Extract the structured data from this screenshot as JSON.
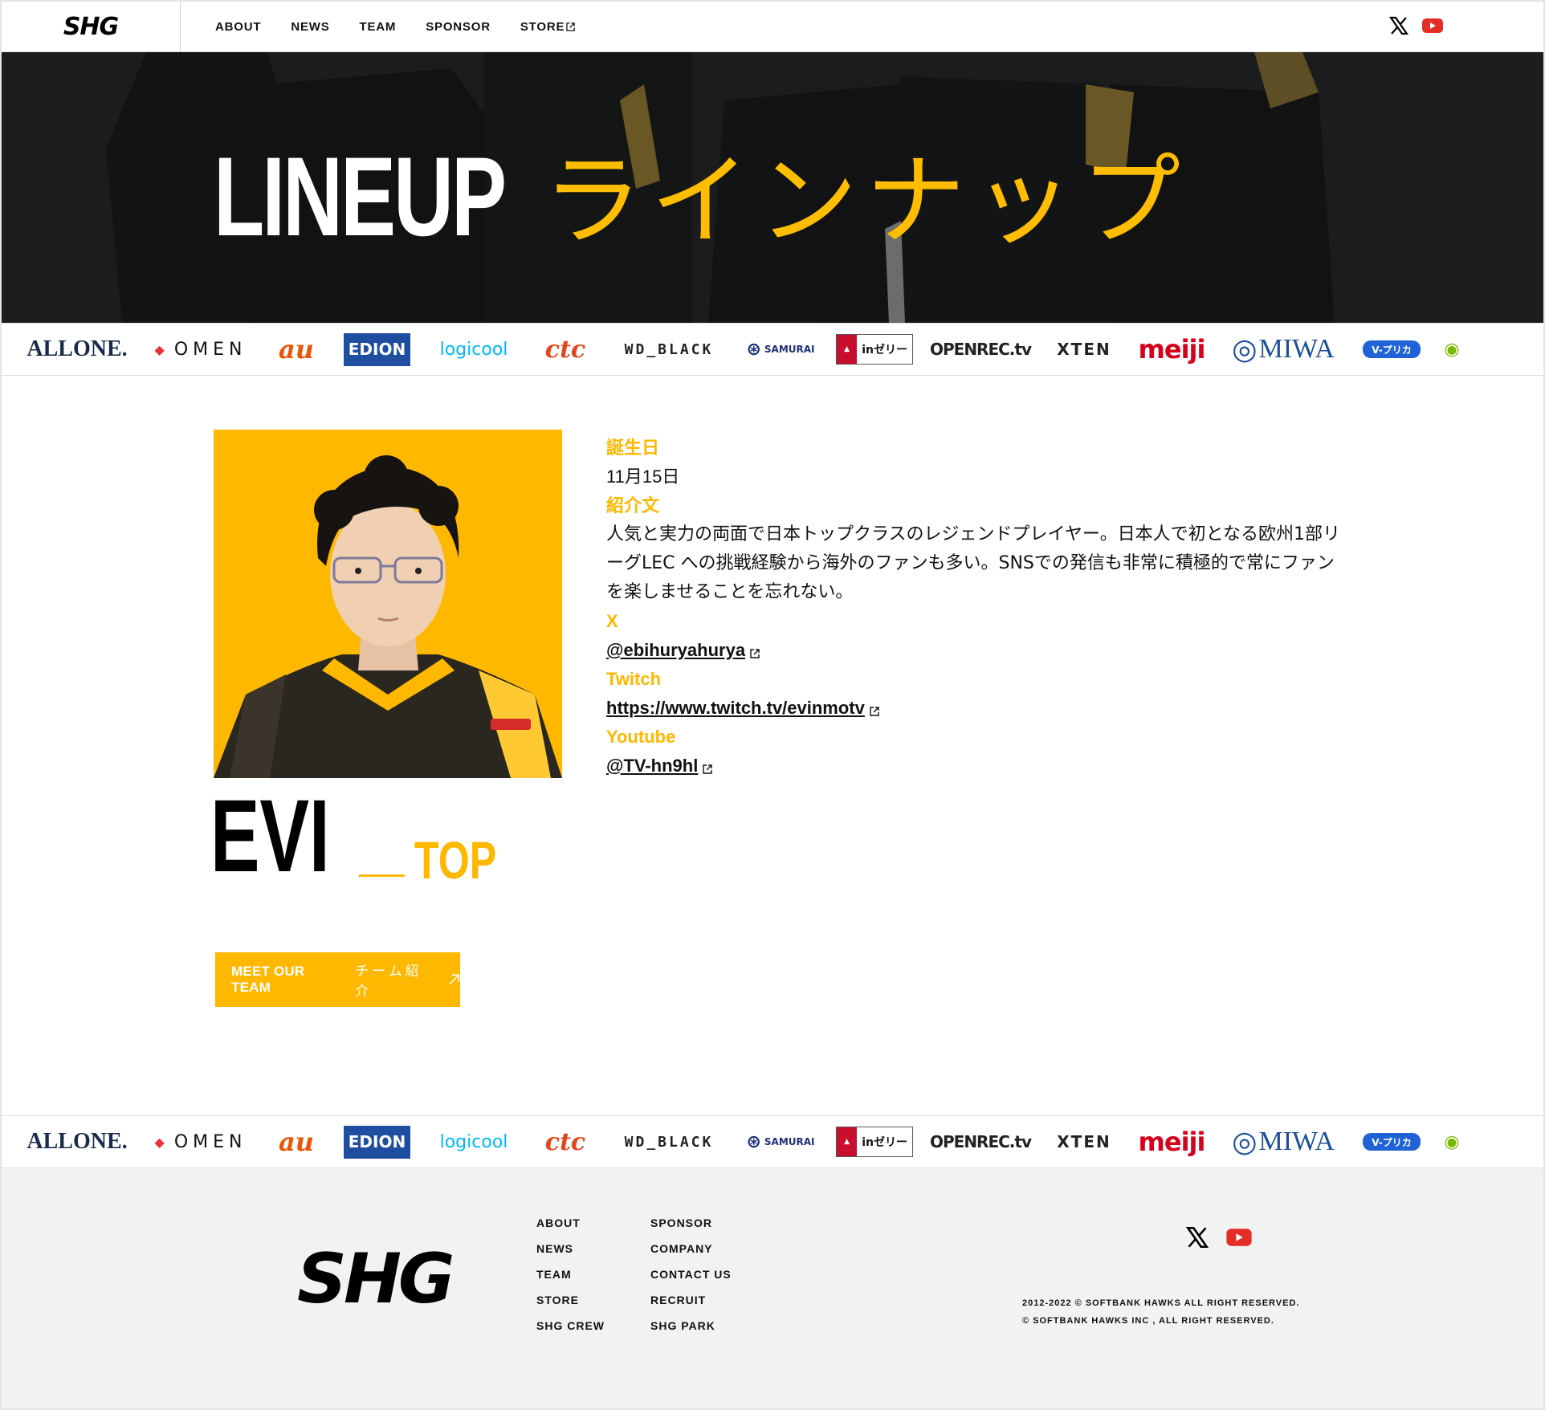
{
  "header": {
    "logo": "SHG",
    "nav": [
      {
        "label": "ABOUT"
      },
      {
        "label": "NEWS"
      },
      {
        "label": "TEAM"
      },
      {
        "label": "SPONSOR"
      },
      {
        "label": "STORE"
      }
    ]
  },
  "hero": {
    "title_en": "LINEUP",
    "title_jp": "ラインナップ"
  },
  "sponsors": [
    "ALLONE.",
    "OMEN",
    "au",
    "EDION",
    "logicool",
    "ctc",
    "WD_BLACK",
    "SAMURAI",
    "inゼリー",
    "OPENREC.tv",
    "XTEN",
    "meiji",
    "MIWA",
    "V-プリカ",
    "NVIDIA"
  ],
  "player": {
    "name": "EVI",
    "role": "TOP",
    "birthday_label": "誕生日",
    "birthday": "11月15日",
    "bio_label": "紹介文",
    "bio": "人気と実力の両面で日本トップクラスのレジェンドプレイヤー。日本人で初となる欧州1部リーグLEC への挑戦経験から海外のファンも多い。SNSでの発信も非常に積極的で常にファンを楽しませることを忘れない。",
    "x_label": "X",
    "x_handle": "@ebihuryahurya",
    "twitch_label": "Twitch",
    "twitch_url": "https://www.twitch.tv/evinmotv",
    "youtube_label": "Youtube",
    "youtube_handle": "@TV-hn9hl"
  },
  "team_button": {
    "en": "MEET OUR TEAM",
    "jp": "チーム紹介"
  },
  "footer": {
    "logo": "SHG",
    "col1": [
      "ABOUT",
      "NEWS",
      "TEAM",
      "STORE",
      "SHG CREW"
    ],
    "col2": [
      "SPONSOR",
      "COMPANY",
      "CONTACT US",
      "RECRUIT",
      "SHG PARK"
    ],
    "copyright1": "2012-2022 © SOFTBANK HAWKS  ALL RIGHT RESERVED.",
    "copyright2": "© SOFTBANK HAWKS  INC , ALL RIGHT RESERVED."
  },
  "colors": {
    "accent": "#ffb800",
    "youtube": "#e52d27"
  }
}
